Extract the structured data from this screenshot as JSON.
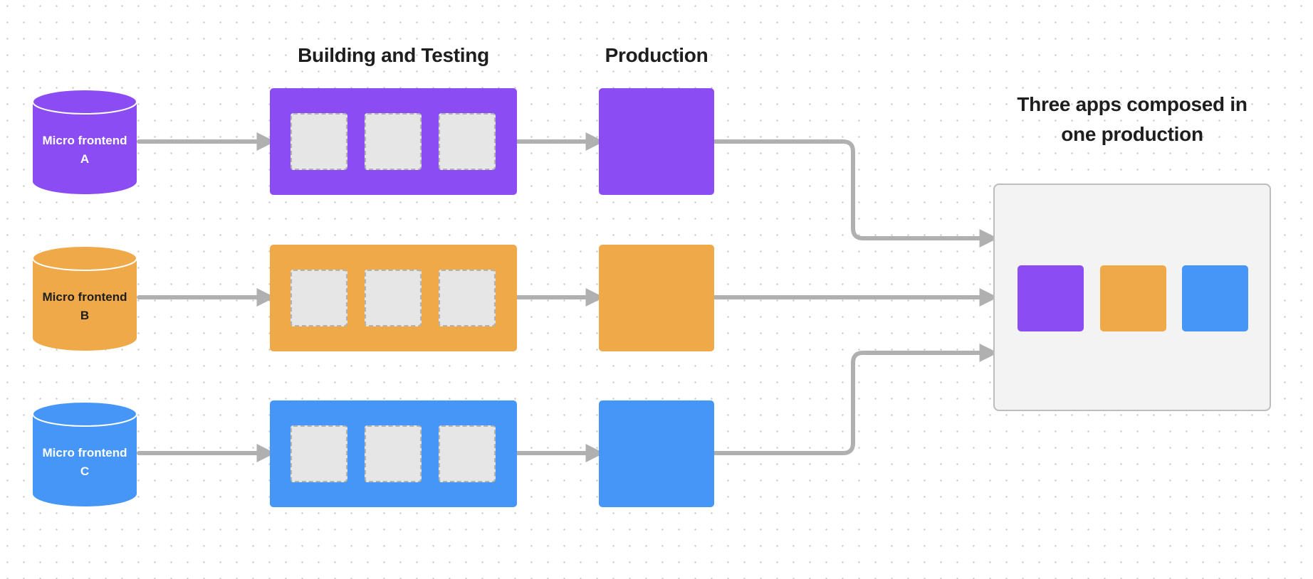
{
  "colors": {
    "a": "#8c4cf3",
    "b": "#f0a948",
    "c": "#4596f6",
    "arrow": "#b0b0b0",
    "slot_fill": "#e6e6e6",
    "composed_fill": "#f3f3f3"
  },
  "headings": {
    "building": "Building and Testing",
    "production": "Production",
    "composed_line1": "Three apps composed in",
    "composed_line2": "one production"
  },
  "rows": [
    {
      "id": "a",
      "name_line1": "Micro frontend",
      "name_line2": "A",
      "label_color": "#ffffff",
      "slots": 3
    },
    {
      "id": "b",
      "name_line1": "Micro frontend",
      "name_line2": "B",
      "label_color": "#1e1e1e",
      "slots": 3
    },
    {
      "id": "c",
      "name_line1": "Micro frontend",
      "name_line2": "C",
      "label_color": "#ffffff",
      "slots": 3
    }
  ],
  "composed": {
    "apps": [
      "a",
      "b",
      "c"
    ]
  }
}
